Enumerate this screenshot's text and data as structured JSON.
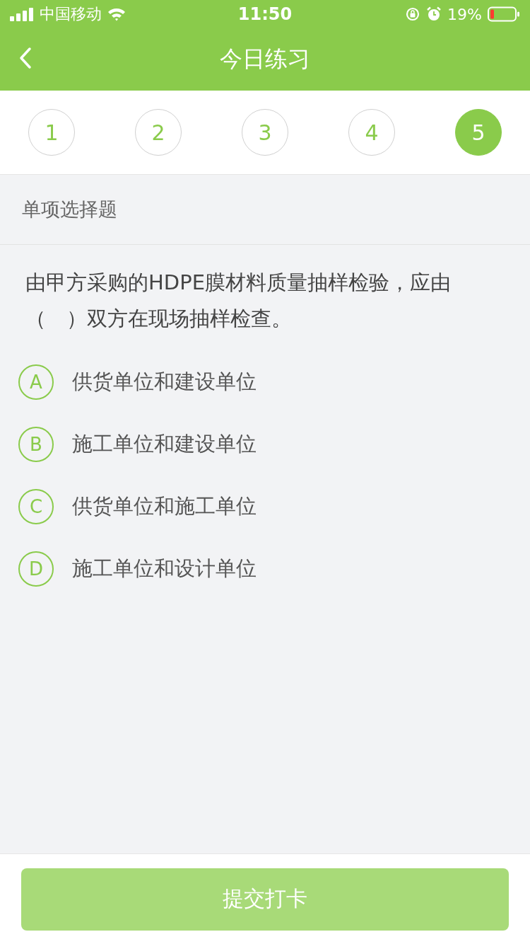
{
  "status_bar": {
    "carrier": "中国移动",
    "time": "11:50",
    "battery_percent": "19%"
  },
  "nav": {
    "title": "今日练习"
  },
  "steps": [
    {
      "label": "1",
      "selected": false
    },
    {
      "label": "2",
      "selected": false
    },
    {
      "label": "3",
      "selected": false
    },
    {
      "label": "4",
      "selected": false
    },
    {
      "label": "5",
      "selected": true
    }
  ],
  "question": {
    "type_label": "单项选择题",
    "text": "由甲方采购的HDPE膜材料质量抽样检验，应由（　）双方在现场抽样检查。",
    "options": [
      {
        "letter": "A",
        "text": "供货单位和建设单位",
        "selected": false
      },
      {
        "letter": "B",
        "text": "施工单位和建设单位",
        "selected": false
      },
      {
        "letter": "C",
        "text": "供货单位和施工单位",
        "selected": false
      },
      {
        "letter": "D",
        "text": "施工单位和设计单位",
        "selected": false
      }
    ]
  },
  "submit": {
    "label": "提交打卡",
    "disabled": true
  }
}
